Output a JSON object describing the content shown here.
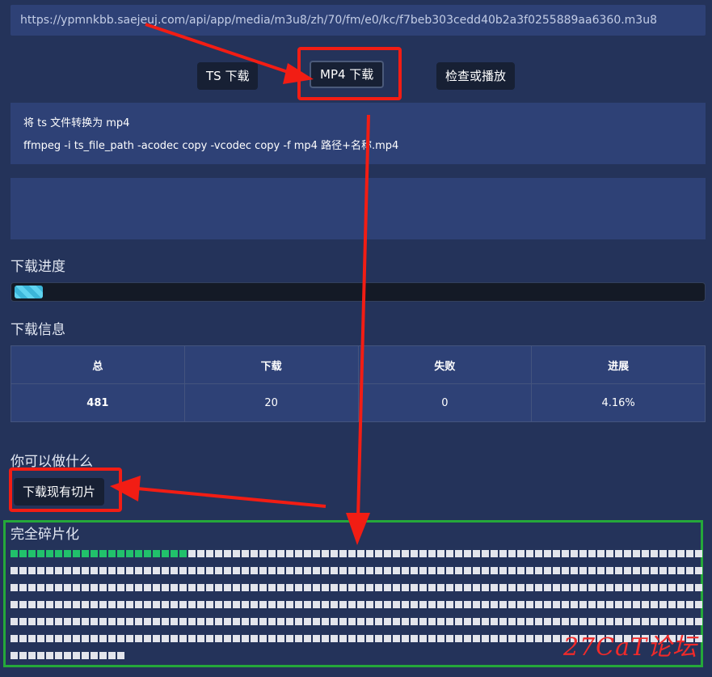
{
  "url": "https://ypmnkbb.saejeuj.com/api/app/media/m3u8/zh/70/fm/e0/kc/f7beb303cedd40b2a3f0255889aa6360.m3u8",
  "buttons": {
    "ts": "TS 下载",
    "mp4": "MP4 下载",
    "check": "检查或播放",
    "download_existing": "下载现有切片"
  },
  "convert": {
    "line1": "将 ts 文件转换为 mp4",
    "line2": "ffmpeg -i ts_file_path -acodec copy -vcodec copy -f mp4 路径+名称.mp4"
  },
  "progress": {
    "title": "下载进度",
    "fraction": 0.0416
  },
  "download_info": {
    "title": "下载信息",
    "headers": [
      "总",
      "下载",
      "失败",
      "进展"
    ],
    "values": [
      "481",
      "20",
      "0",
      "4.16%"
    ]
  },
  "actions": {
    "title": "你可以做什么"
  },
  "fragments": {
    "title": "完全碎片化",
    "total": 481,
    "done": 20
  },
  "watermark": "27CaT论坛",
  "colors": {
    "annotation_red": "#f21d14",
    "frame_green": "#25a83a",
    "segment_done": "#21c16b",
    "segment_pending": "#e3e5ec"
  }
}
